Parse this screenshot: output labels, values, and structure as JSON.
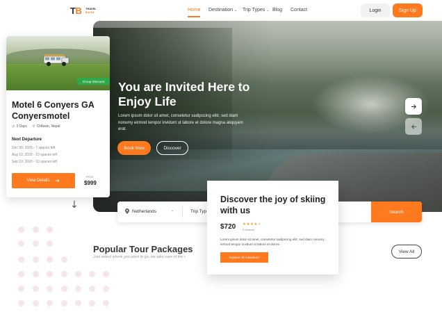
{
  "brand": {
    "mark_t": "T",
    "mark_b": "B",
    "name": "TRAVEL",
    "sub": "BASE",
    "accent": "#ff7a1f"
  },
  "nav": {
    "items": [
      {
        "label": "Home",
        "active": true
      },
      {
        "label": "Destination",
        "caret": "⌄"
      },
      {
        "label": "Trip Types",
        "caret": "⌄"
      },
      {
        "label": "Blog"
      },
      {
        "label": "Contact"
      }
    ],
    "login": "Login",
    "signup": "Sign Up"
  },
  "hero": {
    "title": "You are Invited Here to Enjoy Life",
    "description": "Lorem ipsum dolor sit amet, consetetur sadipscing elitr, sed diam nonumy eirmod tempor invidunt ut labore et dolore magna aliquyam erat.",
    "book_now": "Book Now",
    "discover": "Discover",
    "next_icon": "arrow-right-icon",
    "prev_icon": "arrow-left-icon"
  },
  "search": {
    "destination": "Netherlands",
    "trip_type": "Trip Typ",
    "button": "Search"
  },
  "tour_card": {
    "badge": "Group Discount",
    "title": "Motel 6 Conyers GA Conyersmotel",
    "duration": "3 Days",
    "location": "Chitwan, Nepal",
    "next_departure_label": "Next Departure",
    "departures": [
      {
        "date": "Dec 30, 2020",
        "spaces": "7 spaces left"
      },
      {
        "date": "Aug 12, 2020",
        "spaces": "10 spaces left"
      },
      {
        "date": "Sep 10, 2020",
        "spaces": "10 spaces left"
      }
    ],
    "details_button": "View Details",
    "price_label": "Price",
    "price": "$999",
    "badge_color": "#2ea84a"
  },
  "packages": {
    "title": "Popular Tour Packages",
    "subtitle": "Just select where you want to go, we take care of the r",
    "view_all": "View All"
  },
  "ski_card": {
    "title": "Discover the joy of skiing with us",
    "price": "$720",
    "rating": 4,
    "rating_max": 5,
    "reviews": "5 reviews",
    "description": "Lorem ipsum dolor sit amet, consetetur sadipscing elitr, sed diam nonumy eirmod tempor invidunt ut labore et dolore.",
    "button": "Explore All Adventure"
  }
}
